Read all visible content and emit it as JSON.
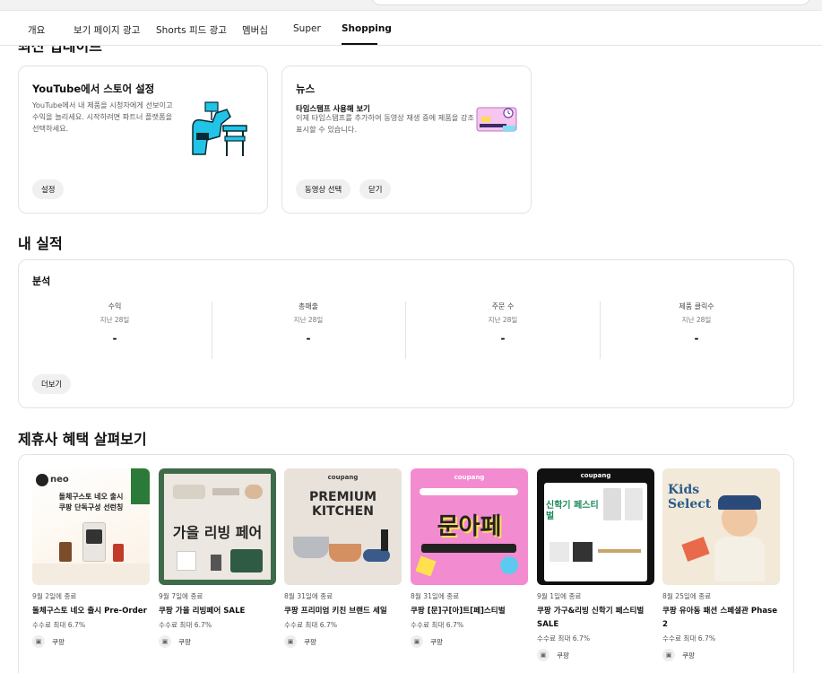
{
  "tabs": [
    "개요",
    "보기 페이지 광고",
    "Shorts 피드 광고",
    "멤버십",
    "Super",
    "Shopping"
  ],
  "active_tab": "Shopping",
  "recent_updates_title": "최신 업데이트",
  "card1": {
    "title": "YouTube에서 스토어 설정",
    "body": "YouTube에서 내 제품을 시청자에게 선보이고 수익을 늘리세요. 시작하려면 파트너 플랫폼을 선택하세요.",
    "button": "설정"
  },
  "card2": {
    "title": "뉴스",
    "subtitle": "타임스탬프 사용해 보기",
    "body": "이제 타임스탬프를 추가하여 동영상 재생 중에 제품을 강조 표시할 수 있습니다.",
    "button_select": "동영상 선택",
    "button_close": "닫기"
  },
  "performance": {
    "title": "내 실적",
    "analysis": "분석",
    "metrics": [
      {
        "label": "수익",
        "period": "지난 28일",
        "value": "-"
      },
      {
        "label": "총매출",
        "period": "지난 28일",
        "value": "-"
      },
      {
        "label": "주문 수",
        "period": "지난 28일",
        "value": "-"
      },
      {
        "label": "제품 클릭수",
        "period": "지난 28일",
        "value": "-"
      }
    ],
    "more": "더보기"
  },
  "affiliate": {
    "title": "제휴사 혜택 살펴보기",
    "offers": [
      {
        "date": "9월 2일에 종료",
        "title": "돌체구스토 네오 출시 Pre-Order",
        "commission": "수수료 최대 6.7%",
        "brand": "쿠팡",
        "thumb_text": "돌체구스토 네오 출시\n쿠팡 단독구성 선런칭"
      },
      {
        "date": "9월 7일에 종료",
        "title": "쿠팡 가을 리빙페어 SALE",
        "commission": "수수료 최대 6.7%",
        "brand": "쿠팡",
        "thumb_text": "가을 리빙 페어"
      },
      {
        "date": "8월 31일에 종료",
        "title": "쿠팡 프리미엄 키친 브랜드 세일",
        "commission": "수수료 최대 6.7%",
        "brand": "쿠팡",
        "thumb_text": "PREMIUM KITCHEN"
      },
      {
        "date": "8월 31일에 종료",
        "title": "쿠팡 [문]구[아]트[페]스티벌",
        "commission": "수수료 최대 6.7%",
        "brand": "쿠팡",
        "thumb_text": "문아페"
      },
      {
        "date": "9월 1일에 종료",
        "title": "쿠팡 가구&리빙 신학기 페스티벌 SALE",
        "commission": "수수료 최대 6.7%",
        "brand": "쿠팡",
        "thumb_text": "신학기 페스티벌"
      },
      {
        "date": "8월 25일에 종료",
        "title": "쿠팡 유아동 패션 스페셜관 Phase 2",
        "commission": "수수료 최대 6.7%",
        "brand": "쿠팡",
        "thumb_text": "Kids Select"
      }
    ]
  },
  "colors": {
    "accent": "#0f0f0f",
    "chip_bg": "#f0f0f0",
    "border": "#e3e3e3",
    "coupang_pink": "#f38bd0"
  }
}
